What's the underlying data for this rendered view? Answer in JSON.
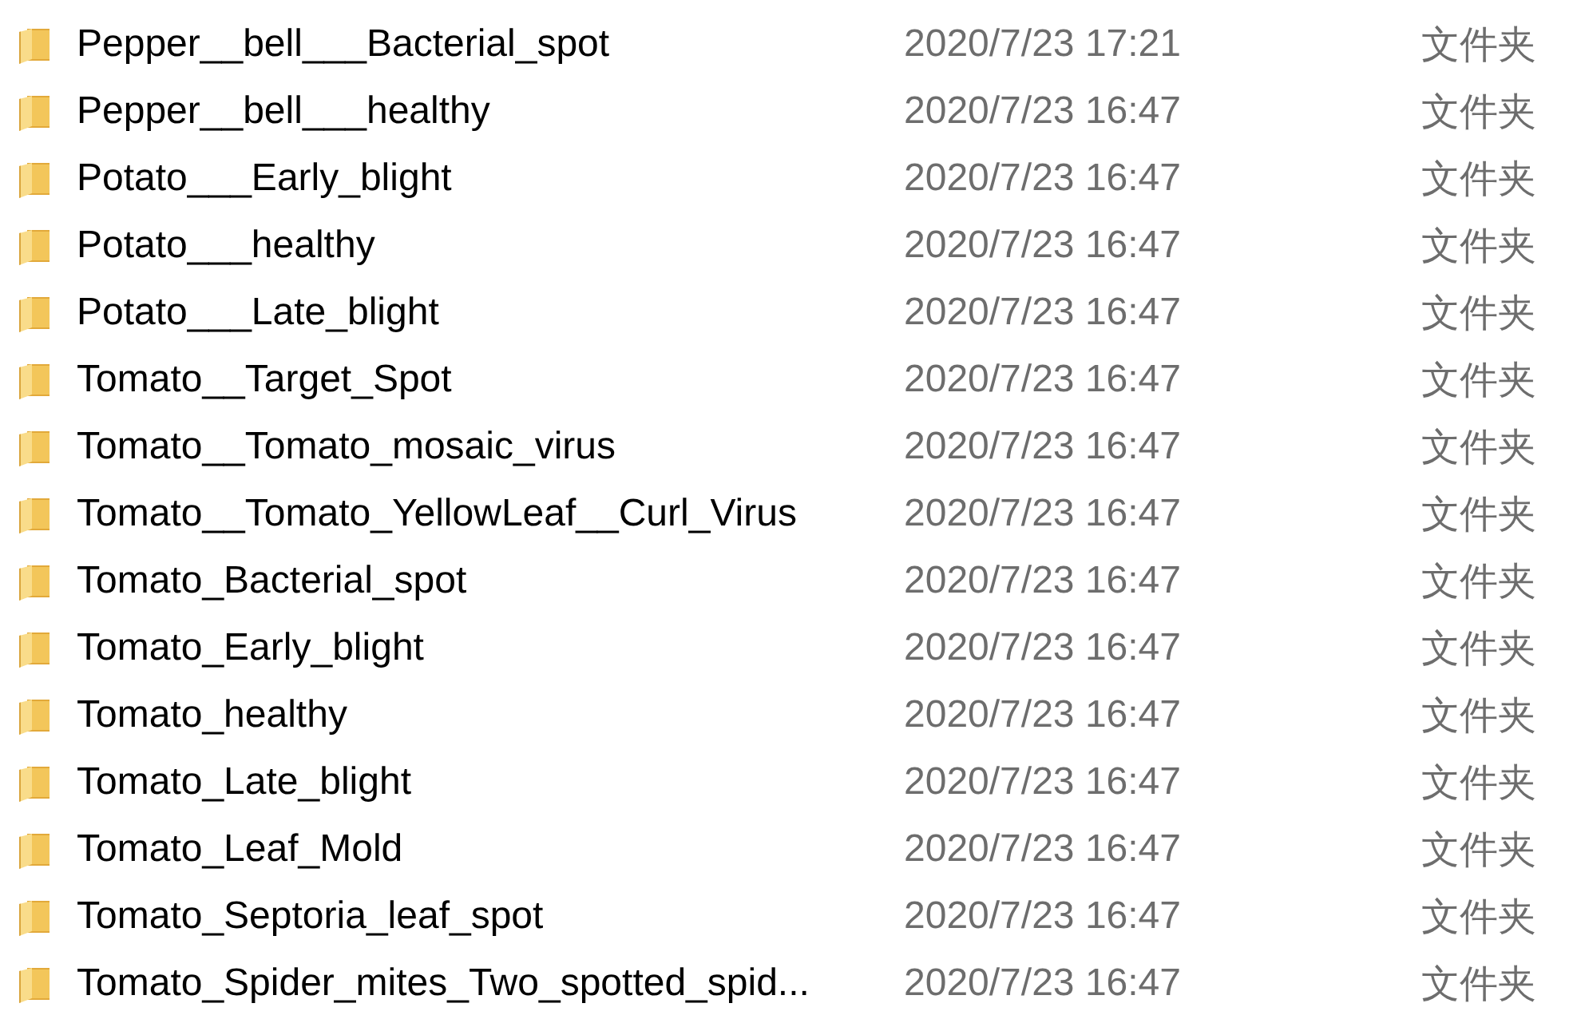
{
  "files": [
    {
      "name": "Pepper__bell___Bacterial_spot",
      "date_modified": "2020/7/23 17:21",
      "type": "文件夹"
    },
    {
      "name": "Pepper__bell___healthy",
      "date_modified": "2020/7/23 16:47",
      "type": "文件夹"
    },
    {
      "name": "Potato___Early_blight",
      "date_modified": "2020/7/23 16:47",
      "type": "文件夹"
    },
    {
      "name": "Potato___healthy",
      "date_modified": "2020/7/23 16:47",
      "type": "文件夹"
    },
    {
      "name": "Potato___Late_blight",
      "date_modified": "2020/7/23 16:47",
      "type": "文件夹"
    },
    {
      "name": "Tomato__Target_Spot",
      "date_modified": "2020/7/23 16:47",
      "type": "文件夹"
    },
    {
      "name": "Tomato__Tomato_mosaic_virus",
      "date_modified": "2020/7/23 16:47",
      "type": "文件夹"
    },
    {
      "name": "Tomato__Tomato_YellowLeaf__Curl_Virus",
      "date_modified": "2020/7/23 16:47",
      "type": "文件夹"
    },
    {
      "name": "Tomato_Bacterial_spot",
      "date_modified": "2020/7/23 16:47",
      "type": "文件夹"
    },
    {
      "name": "Tomato_Early_blight",
      "date_modified": "2020/7/23 16:47",
      "type": "文件夹"
    },
    {
      "name": "Tomato_healthy",
      "date_modified": "2020/7/23 16:47",
      "type": "文件夹"
    },
    {
      "name": "Tomato_Late_blight",
      "date_modified": "2020/7/23 16:47",
      "type": "文件夹"
    },
    {
      "name": "Tomato_Leaf_Mold",
      "date_modified": "2020/7/23 16:47",
      "type": "文件夹"
    },
    {
      "name": "Tomato_Septoria_leaf_spot",
      "date_modified": "2020/7/23 16:47",
      "type": "文件夹"
    },
    {
      "name": "Tomato_Spider_mites_Two_spotted_spid...",
      "date_modified": "2020/7/23 16:47",
      "type": "文件夹"
    }
  ]
}
